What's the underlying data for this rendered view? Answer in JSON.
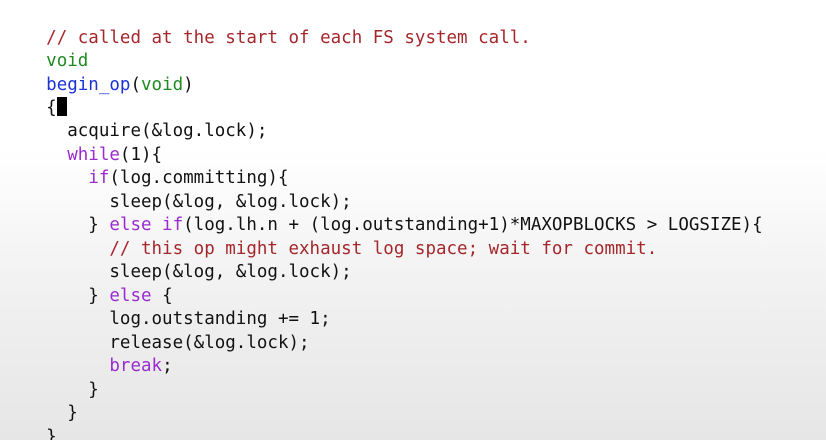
{
  "code": {
    "l1": {
      "comment": "// called at the start of each FS system call."
    },
    "l2": {
      "type": "void"
    },
    "l3": {
      "func": "begin_op",
      "open_paren": "(",
      "arg": "void",
      "close_paren": ")"
    },
    "l4": {
      "brace": "{"
    },
    "l5": {
      "text": "  acquire(&log.lock);"
    },
    "l6": {
      "indent": "  ",
      "kw": "while",
      "rest": "(1){"
    },
    "l7": {
      "indent": "    ",
      "kw": "if",
      "rest": "(log.committing){"
    },
    "l8": {
      "text": "      sleep(&log, &log.lock);"
    },
    "l9": {
      "indent": "    } ",
      "kw": "else if",
      "rest": "(log.lh.n + (log.outstanding+1)*MAXOPBLOCKS > LOGSIZE){"
    },
    "l10": {
      "indent": "      ",
      "comment": "// this op might exhaust log space; wait for commit."
    },
    "l11": {
      "text": "      sleep(&log, &log.lock);"
    },
    "l12": {
      "indent": "    } ",
      "kw": "else",
      "rest": " {"
    },
    "l13": {
      "text": "      log.outstanding += 1;"
    },
    "l14": {
      "text": "      release(&log.lock);"
    },
    "l15": {
      "indent": "      ",
      "kw": "break",
      "rest": ";"
    },
    "l16": {
      "text": "    }"
    },
    "l17": {
      "text": "  }"
    },
    "l18": {
      "text": "}"
    }
  },
  "colors": {
    "comment": "#a5262b",
    "type": "#1f8a1f",
    "function": "#1a32d6",
    "keyword": "#9a2bd0",
    "text": "#111111"
  }
}
